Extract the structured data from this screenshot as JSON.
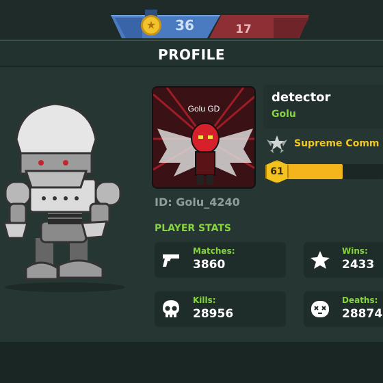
{
  "score": {
    "blue_team": "36",
    "red_team": "17",
    "medal_icon": "star-medal-icon"
  },
  "profile": {
    "title": "PROFILE",
    "avatar_name": "Golu GD",
    "player_name": "detector",
    "clan_name": "Golu",
    "player_id": "ID: Golu_4240",
    "rank": "Supreme Comm",
    "rank_icon": "winged-star-rank-icon",
    "level": "61",
    "level_progress": 0.6
  },
  "stats": {
    "heading": "PLAYER STATS",
    "matches": {
      "label": "Matches:",
      "value": "3860",
      "icon": "pistol-icon"
    },
    "wins": {
      "label": "Wins:",
      "value": "2433",
      "icon": "star-icon"
    },
    "kills": {
      "label": "Kills:",
      "value": "28956",
      "icon": "skull-icon"
    },
    "deaths": {
      "label": "Deaths:",
      "value": "28874",
      "icon": "dead-face-icon"
    }
  },
  "colors": {
    "accent_green": "#86d43f",
    "rank_gold": "#f3c722",
    "level_bar": "#f4b51c",
    "blue_team": "#4a7bc0",
    "red_team": "#8e2f36"
  }
}
